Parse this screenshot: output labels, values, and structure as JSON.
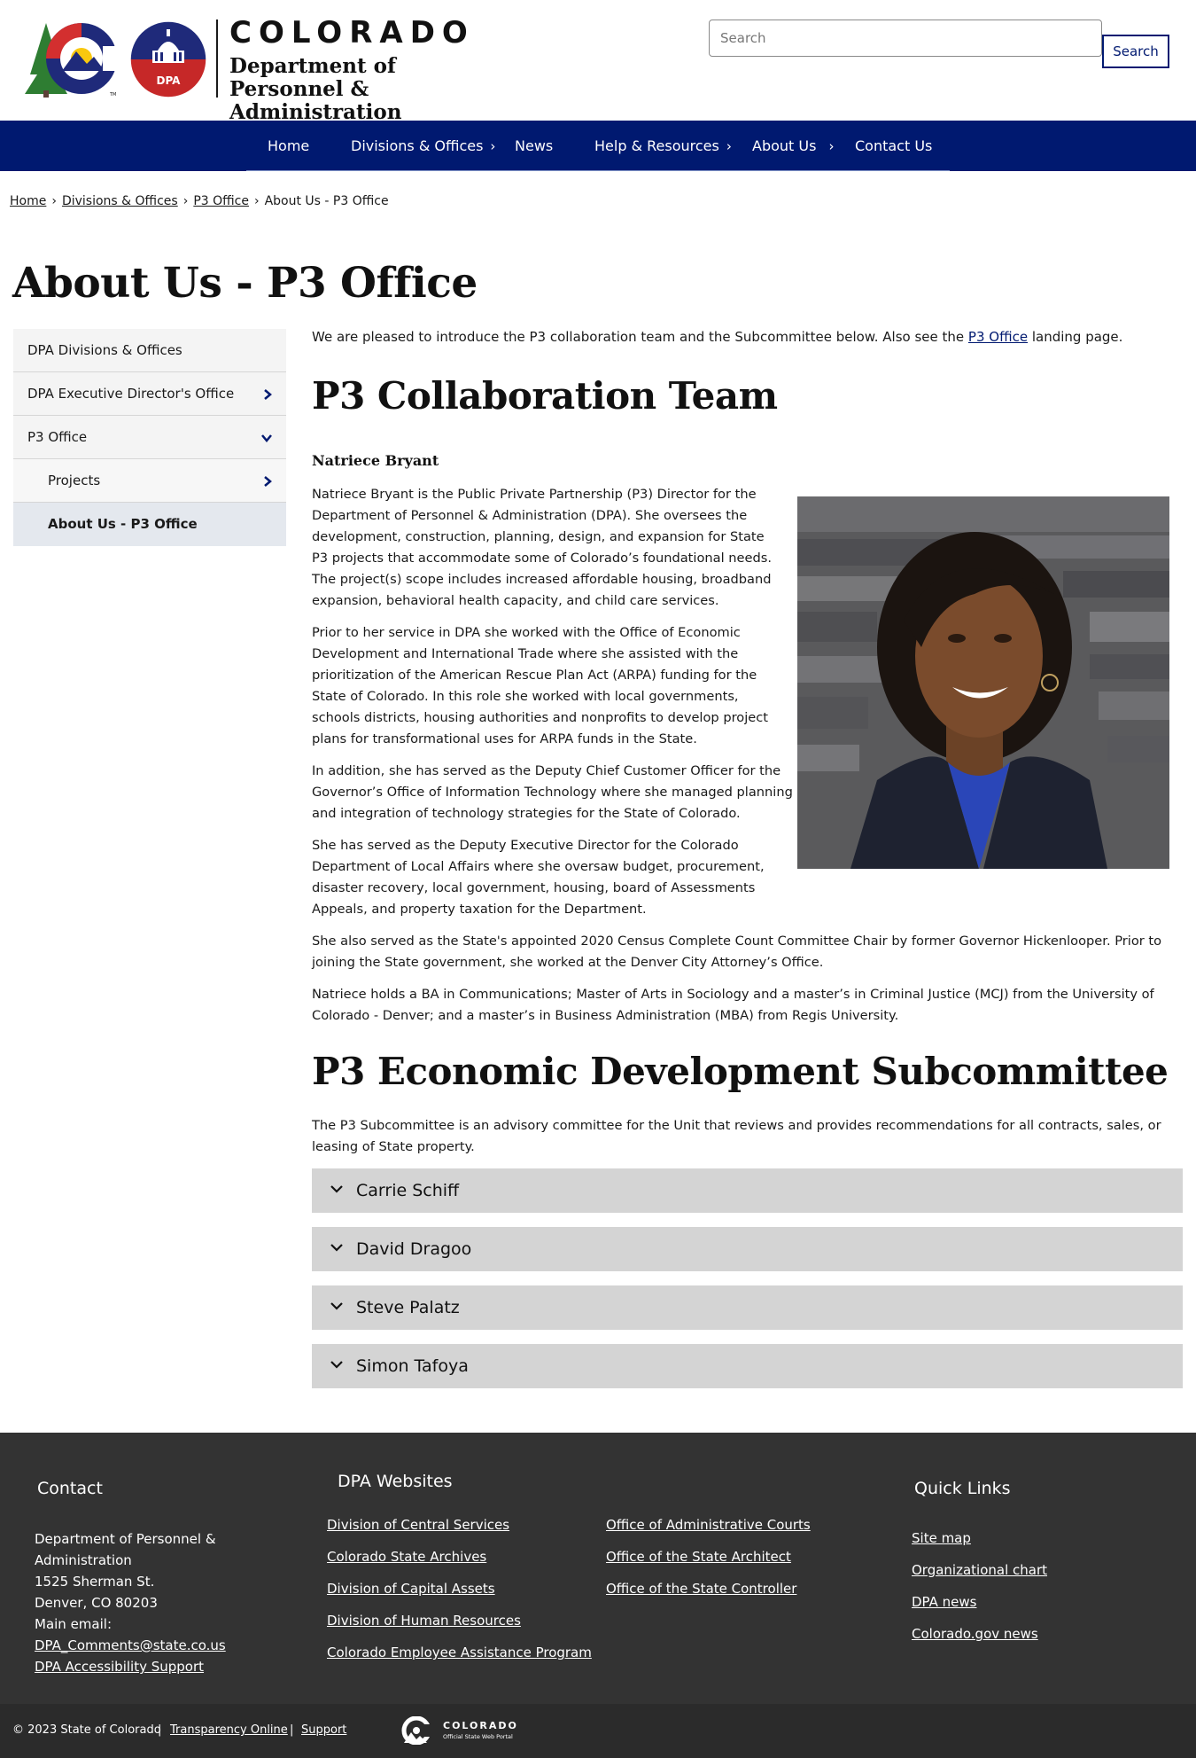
{
  "header": {
    "brand_state": "COLORADO",
    "brand_dept": "Department of Personnel & Administration",
    "dpa_badge": "DPA",
    "tm": "TM",
    "search_placeholder": "Search",
    "search_button": "Search"
  },
  "nav": {
    "items": [
      {
        "label": "Home",
        "chevron": false
      },
      {
        "label": "Divisions & Offices",
        "chevron": true
      },
      {
        "label": "News",
        "chevron": false
      },
      {
        "label": "Help & Resources",
        "chevron": true
      },
      {
        "label": "About Us",
        "chevron": true
      },
      {
        "label": "Contact Us",
        "chevron": false
      }
    ],
    "chevron_glyph": "›"
  },
  "breadcrumb": {
    "links": [
      "Home",
      "Divisions & Offices",
      "P3 Office"
    ],
    "current": "About Us - P3 Office",
    "separator": "›"
  },
  "page_title": "About Us - P3 Office",
  "sidebar": {
    "items": [
      {
        "label": "DPA Divisions & Offices",
        "icon": "none"
      },
      {
        "label": "DPA Executive Director's Office",
        "icon": "chevron-right"
      },
      {
        "label": "P3 Office",
        "icon": "chevron-down"
      },
      {
        "label": "Projects",
        "icon": "chevron-right"
      },
      {
        "label": "About Us - P3 Office",
        "icon": "none"
      }
    ]
  },
  "main": {
    "intro_before": "We are pleased to introduce the P3 collaboration team and the Subcommittee below. Also see the",
    "intro_link": "P3 Office",
    "intro_after": "landing page.",
    "team_heading": "P3 Collaboration Team",
    "person_name": "Natriece Bryant",
    "bio": [
      "Natriece Bryant is the Public Private Partnership (P3) Director for the Department of Personnel & Administration (DPA). She oversees the development, construction, planning, design, and expansion for State P3 projects that accommodate some of Colorado’s foundational needs. The project(s) scope includes increased affordable housing, broadband expansion, behavioral health capacity, and child care services.",
      "Prior to her service in DPA she worked with the Office of Economic Development and International Trade where she assisted with the prioritization of the American Rescue Plan Act (ARPA) funding for the State of Colorado. In this role she worked with local governments, schools districts, housing authorities and nonprofits to develop project plans for transformational uses for ARPA funds in the State.",
      "In addition, she has served as the Deputy Chief Customer Officer for the Governor’s Office of Information Technology where she managed planning and integration of technology strategies for the State of Colorado.",
      "She has served as the Deputy Executive Director for the Colorado Department of Local Affairs where she oversaw budget, procurement, disaster recovery, local government, housing, board of Assessments Appeals, and property taxation for the Department.",
      "She also served as the State's appointed 2020 Census Complete Count Committee Chair by former Governor Hickenlooper. Prior to joining the State government, she worked at the Denver City Attorney’s Office.",
      "Natriece holds a BA in Communications; Master of Arts in Sociology and a master’s in Criminal Justice (MCJ) from the University of Colorado - Denver;  and a master’s in Business Administration (MBA) from Regis University."
    ],
    "subcommittee_heading": "P3 Economic Development Subcommittee",
    "subcommittee_intro": "The P3 Subcommittee is an advisory committee for the Unit that reviews and provides recommendations for all contracts, sales, or leasing of State property.",
    "members": [
      "Carrie Schiff",
      "David Dragoo",
      "Steve Palatz",
      "Simon Tafoya"
    ]
  },
  "footer": {
    "contact": {
      "heading": "Contact",
      "lines": [
        "Department of Personnel &",
        "Administration",
        "1525 Sherman St.",
        "Denver, CO 80203",
        "Main email:"
      ],
      "email": "DPA_Comments@state.co.us",
      "accessibility": "DPA Accessibility Support"
    },
    "websites": {
      "heading": "DPA Websites",
      "col1": [
        "Division of Central Services",
        "Colorado State Archives",
        "Division of Capital Assets",
        "Division of Human Resources",
        "Colorado Employee Assistance Program"
      ],
      "col2": [
        "Office of Administrative Courts",
        "Office of the State Architect",
        "Office of the State Controller"
      ]
    },
    "quick_links": {
      "heading": "Quick Links",
      "links": [
        "Site map",
        "Organizational chart",
        "DPA news",
        "Colorado.gov news"
      ]
    },
    "bottom": {
      "copyright": "© 2023 State of Colorado",
      "divider": "|",
      "transparency": "Transparency Online",
      "support": "Support",
      "portal_name": "COLORADO",
      "portal_sub": "Official State Web Portal"
    }
  },
  "colors": {
    "nav_bg": "#001970",
    "footer_bg": "#333333",
    "bottom_bar_bg": "#2b2b2b",
    "accordion_bg": "#d4d4d4",
    "sidebar_active_bg": "#e4e8ee"
  }
}
